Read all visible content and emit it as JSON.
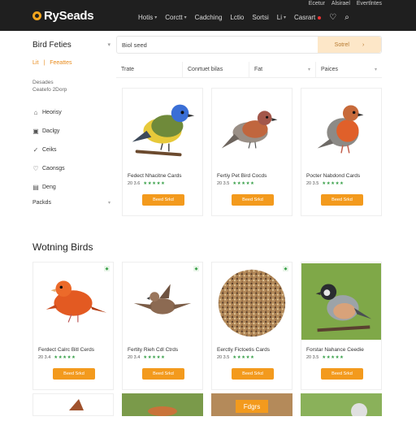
{
  "header": {
    "logo": "RySeads",
    "top_links": [
      "Ecetur",
      "Alsirael",
      "Evertlntes"
    ],
    "nav": [
      {
        "label": "Hotis",
        "caret": true
      },
      {
        "label": "Corctt",
        "caret": true
      },
      {
        "label": "Cadching",
        "caret": false
      },
      {
        "label": "Lctio",
        "caret": false
      },
      {
        "label": "Sortsi",
        "caret": false
      },
      {
        "label": "Li",
        "caret": true
      },
      {
        "label": "Casrart",
        "caret": false
      }
    ]
  },
  "sidebar": {
    "title": "Bird Feties",
    "tabs": [
      "Lit",
      "Feeattes"
    ],
    "subtitle": "Desades\nCeatefo 2Dorp",
    "items": [
      {
        "label": "Heorisy",
        "icon": "house-icon"
      },
      {
        "label": "Daclgy",
        "icon": "feeder-icon"
      },
      {
        "label": "Ceiks",
        "icon": "bird-icon"
      },
      {
        "label": "Caonsgs",
        "icon": "heart-icon"
      },
      {
        "label": "Deng",
        "icon": "box-icon"
      }
    ],
    "more": "Packds"
  },
  "search": {
    "value": "Biol seed",
    "button": "Sotrel"
  },
  "filters": [
    {
      "label": "Trate",
      "caret": false
    },
    {
      "label": "Conrtuet bilas",
      "caret": false
    },
    {
      "label": "Fat",
      "caret": true
    },
    {
      "label": "Paices",
      "caret": true
    }
  ],
  "products_top": [
    {
      "name": "Fedect Nhacitne Cards",
      "price": "20 3.6",
      "stars": "★★★★★"
    },
    {
      "name": "Fertiy Pet Bird Cocds",
      "price": "20 3.5",
      "stars": "★★★★★"
    },
    {
      "name": "Pocter Nabdond Cards",
      "price": "20 3.5",
      "stars": "★★★★★"
    }
  ],
  "button_label": "Beed Srkd",
  "section_title": "Wotning Birds",
  "products_bottom": [
    {
      "name": "Ferdect Calrc Bitl Cerds",
      "price": "20 3.4",
      "stars": "★★★★★"
    },
    {
      "name": "Fertity Rieh Cdl Ctrds",
      "price": "20 3.4",
      "stars": "★★★★★"
    },
    {
      "name": "Eerctly Fictoetis Cards",
      "price": "20 3.5",
      "stars": "★★★★★"
    },
    {
      "name": "Forstar Nahance Ceedie",
      "price": "20 3.5",
      "stars": "★★★★★"
    }
  ],
  "promo_label": "Fdgrs",
  "colors": {
    "header_bg": "#1f1f1f",
    "accent": "#f39a1d",
    "search_button_bg": "#fde7c8",
    "rating": "#3aa14a"
  }
}
